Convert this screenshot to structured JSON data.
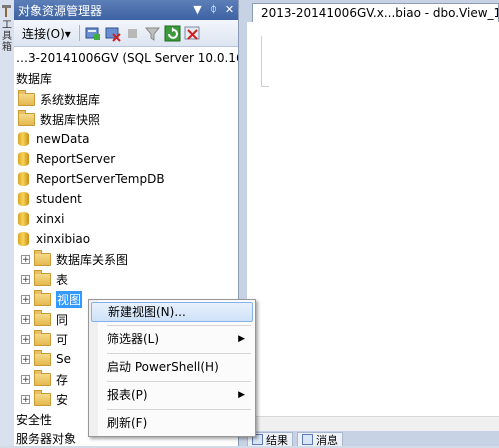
{
  "left_strip": {
    "label": "工具箱"
  },
  "panel": {
    "title": "对象资源管理器",
    "controls": [
      "▼",
      "ᛰ",
      "✕"
    ],
    "toolbar": {
      "connect_label": "连接(O)▾"
    }
  },
  "tree": {
    "server": "…3-20141006GV (SQL Server 10.0.1600",
    "databases": "数据库",
    "system_db": "系统数据库",
    "db_snapshot": "数据库快照",
    "dbs": [
      "newData",
      "ReportServer",
      "ReportServerTempDB",
      "student",
      "xinxi",
      "xinxibiao"
    ],
    "sub_items": [
      "数据库关系图",
      "表",
      "视图",
      "同",
      "可",
      "Se",
      "存",
      "安"
    ],
    "security": "安全性",
    "server_objects": "服务器对象"
  },
  "editor": {
    "tab_title": "2013-20141006GV.x...biao - dbo.View_1*",
    "bottom_tabs": [
      "结果",
      "消息"
    ]
  },
  "context_menu": {
    "items": [
      {
        "label": "新建视图(N)...",
        "submenu": false
      },
      {
        "label": "筛选器(L)",
        "submenu": true
      },
      {
        "label": "启动 PowerShell(H)",
        "submenu": false
      },
      {
        "label": "报表(P)",
        "submenu": true
      },
      {
        "label": "刷新(F)",
        "submenu": false
      }
    ]
  },
  "colors": {
    "title_bar": "#3e62a2",
    "selection": "#3399ff",
    "menu_highlight": "#cfe2f8"
  }
}
